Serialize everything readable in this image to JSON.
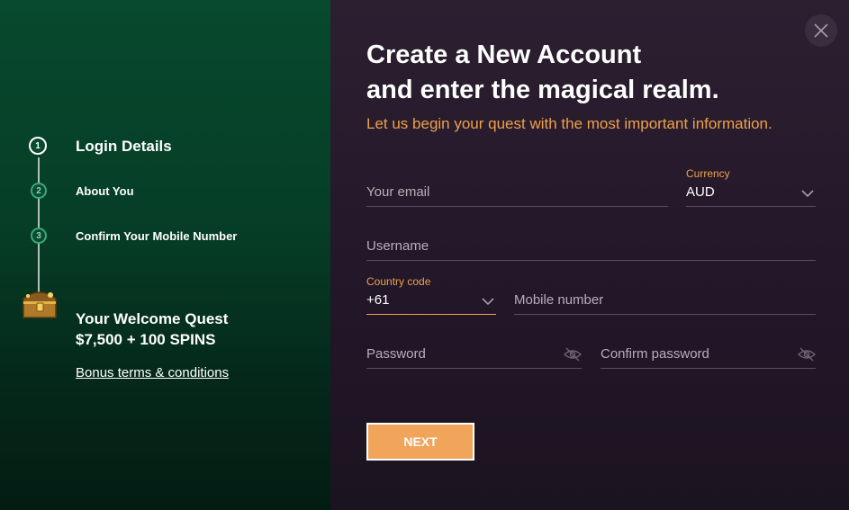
{
  "sidebar": {
    "steps": [
      {
        "number": "1",
        "label": "Login Details"
      },
      {
        "number": "2",
        "label": "About You"
      },
      {
        "number": "3",
        "label": "Confirm Your Mobile Number"
      }
    ],
    "bonus_icon": "treasure-chest-icon",
    "quest_line1": "Your Welcome Quest",
    "quest_line2": "$7,500 + 100 SPINS",
    "terms_link": "Bonus terms & conditions"
  },
  "form": {
    "title_line1": "Create a New Account",
    "title_line2": "and enter the magical realm.",
    "subtitle": "Let us begin your quest with the most important information.",
    "email_placeholder": "Your email",
    "currency_label": "Currency",
    "currency_value": "AUD",
    "username_placeholder": "Username",
    "country_code_label": "Country code",
    "country_code_value": "+61",
    "mobile_placeholder": "Mobile number",
    "password_placeholder": "Password",
    "confirm_password_placeholder": "Confirm password",
    "next_label": "NEXT"
  },
  "icons": {
    "close": "close-icon",
    "dropdown": "chevron-down-icon",
    "password_toggle": "eye-slash-icon"
  },
  "colors": {
    "accent": "#f0a04b",
    "sidebar_bg": "#074a2e",
    "panel_bg": "#2c1f30",
    "button_bg": "#f0a55a"
  }
}
